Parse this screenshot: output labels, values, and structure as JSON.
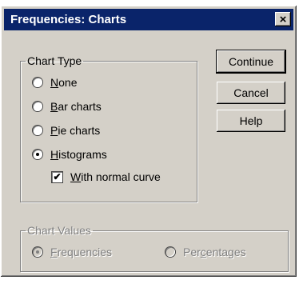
{
  "window": {
    "title": "Frequencies: Charts",
    "close_glyph": "×"
  },
  "chart_type": {
    "legend": "Chart Type",
    "options": [
      {
        "key": "N",
        "rest": "one",
        "selected": false
      },
      {
        "key": "B",
        "rest": "ar charts",
        "selected": false
      },
      {
        "key": "P",
        "rest": "ie charts",
        "selected": false
      },
      {
        "key": "H",
        "rest": "istograms",
        "selected": true
      }
    ],
    "normal_curve": {
      "key": "W",
      "rest": "ith normal curve",
      "checked": true,
      "mark": "✔"
    }
  },
  "chart_values": {
    "legend": "Chart Values",
    "enabled": false,
    "frequencies": {
      "key": "F",
      "rest": "requencies",
      "selected": true
    },
    "percentages": {
      "pre": "Per",
      "key": "c",
      "rest": "entages",
      "selected": false
    }
  },
  "buttons": {
    "continue": "Continue",
    "cancel": "Cancel",
    "help": "Help"
  },
  "colors": {
    "titlebar": "#0a246a",
    "face": "#d4d0c8",
    "disabled_text": "#808080"
  }
}
